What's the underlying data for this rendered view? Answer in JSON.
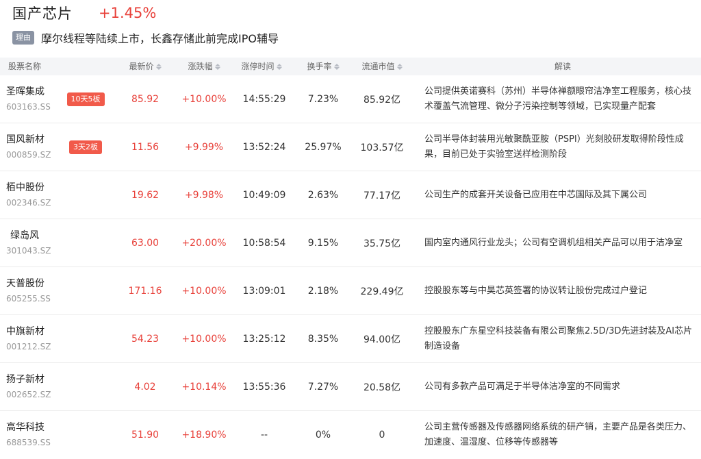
{
  "sector": {
    "title": "国产芯片",
    "change": "+1.45%"
  },
  "reason": {
    "tag": "理由",
    "text": "摩尔线程等陆续上市，长鑫存储此前完成IPO辅导"
  },
  "columns": {
    "name": "股票名称",
    "price": "最新价",
    "change": "涨跌幅",
    "limit_time": "涨停时间",
    "turnover": "换手率",
    "market_cap": "流通市值",
    "desc": "解读"
  },
  "rows": [
    {
      "name": "圣晖集成",
      "code": "603163.SS",
      "badge": "10天5板",
      "price": "85.92",
      "change": "+10.00%",
      "limit_time": "14:55:29",
      "turnover": "7.23%",
      "market_cap": "85.92亿",
      "desc": "公司提供英诺赛科（苏州）半导体禅额眼帘洁净室工程服务，核心技术覆盖气流管理、微分子污染控制等领域，已实现量产配套"
    },
    {
      "name": "国风新材",
      "code": "000859.SZ",
      "badge": "3天2板",
      "price": "11.56",
      "change": "+9.99%",
      "limit_time": "13:52:24",
      "turnover": "25.97%",
      "market_cap": "103.57亿",
      "desc": "公司半导体封装用光敏聚酰亚胺（PSPI）光刻胶研发取得阶段性成果，目前已处于实验室送样检测阶段"
    },
    {
      "name": "栢中股份",
      "code": "002346.SZ",
      "badge": "",
      "price": "19.62",
      "change": "+9.98%",
      "limit_time": "10:49:09",
      "turnover": "2.63%",
      "market_cap": "77.17亿",
      "desc": "公司生产的成套开关设备已应用在中芯国际及其下属公司"
    },
    {
      "name": "绿岛风",
      "code": "301043.SZ",
      "badge": "",
      "price": "63.00",
      "change": "+20.00%",
      "limit_time": "10:58:54",
      "turnover": "9.15%",
      "market_cap": "35.75亿",
      "desc": "国内室内通风行业龙头；公司有空调机组相关产品可以用于洁净室"
    },
    {
      "name": "天普股份",
      "code": "605255.SS",
      "badge": "",
      "price": "171.16",
      "change": "+10.00%",
      "limit_time": "13:09:01",
      "turnover": "2.18%",
      "market_cap": "229.49亿",
      "desc": "控股股东等与中昊芯英签署的协议转让股份完成过户登记"
    },
    {
      "name": "中旗新材",
      "code": "001212.SZ",
      "badge": "",
      "price": "54.23",
      "change": "+10.00%",
      "limit_time": "13:25:12",
      "turnover": "8.35%",
      "market_cap": "94.00亿",
      "desc": "控股股东广东星空科技装备有限公司聚焦2.5D/3D先进封装及AI芯片制造设备"
    },
    {
      "name": "扬子新材",
      "code": "002652.SZ",
      "badge": "",
      "price": "4.02",
      "change": "+10.14%",
      "limit_time": "13:55:36",
      "turnover": "7.27%",
      "market_cap": "20.58亿",
      "desc": "公司有多款产品可满足于半导体洁净室的不同需求"
    },
    {
      "name": "高华科技",
      "code": "688539.SS",
      "badge": "",
      "price": "51.90",
      "change": "+18.90%",
      "limit_time": "--",
      "turnover": "0%",
      "market_cap": "0",
      "desc": "公司主营传感器及传感器网络系统的研产销，主要产品是各类压力、加速度、温湿度、位移等传感器等"
    }
  ],
  "colors": {
    "up": "#e8413a",
    "badge": "#f15a4a",
    "tag": "#8a93a3",
    "header_bg": "#f4f5f7"
  }
}
